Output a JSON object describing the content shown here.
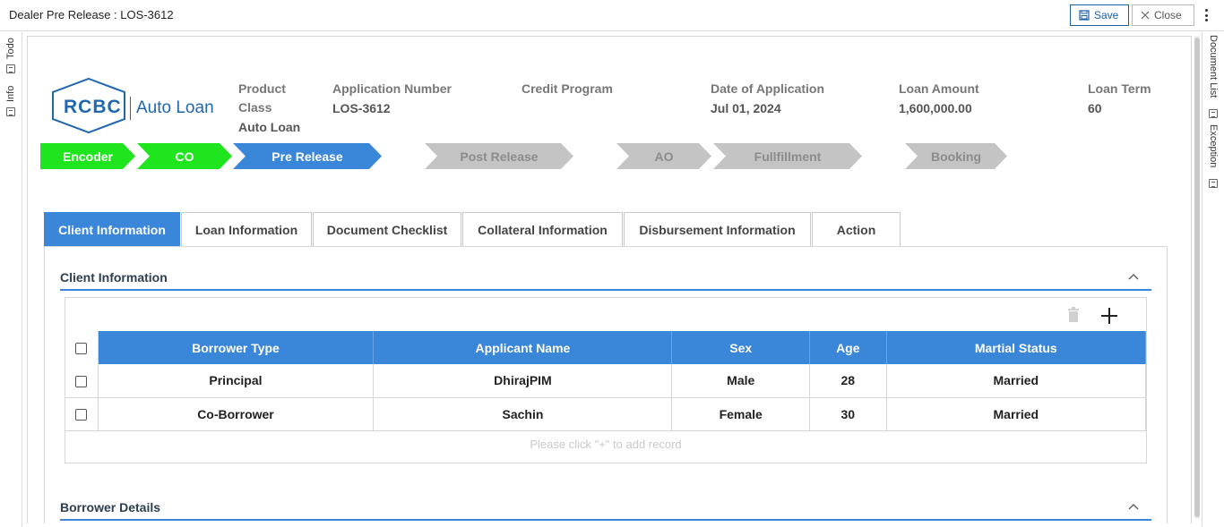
{
  "window": {
    "title": "Dealer Pre Release : LOS-3612",
    "save_label": "Save",
    "close_label": "Close"
  },
  "left_rail": {
    "todo_label": "Todo",
    "info_label": "Info"
  },
  "right_rail": {
    "document_list_label": "Document List",
    "exception_label": "Exception"
  },
  "logo": {
    "brand": "RCBC",
    "product": "Auto Loan"
  },
  "header": {
    "product_class_label": "Product Class",
    "product_class_value": "Auto Loan",
    "application_number_label": "Application Number",
    "application_number_value": "LOS-3612",
    "credit_program_label": "Credit Program",
    "credit_program_value": "",
    "date_label": "Date of Application",
    "date_value": "Jul 01, 2024",
    "loan_amount_label": "Loan Amount",
    "loan_amount_value": "1,600,000.00",
    "loan_term_label": "Loan Term",
    "loan_term_value": "60"
  },
  "stepper": [
    {
      "label": "Encoder",
      "state": "done"
    },
    {
      "label": "CO",
      "state": "done"
    },
    {
      "label": "Pre Release",
      "state": "current"
    },
    {
      "label": "Post Release",
      "state": "todo"
    },
    {
      "label": "AO",
      "state": "todo"
    },
    {
      "label": "Fullfillment",
      "state": "todo"
    },
    {
      "label": "Booking",
      "state": "todo"
    }
  ],
  "tabs": [
    {
      "label": "Client Information",
      "active": true
    },
    {
      "label": "Loan Information"
    },
    {
      "label": "Document Checklist"
    },
    {
      "label": "Collateral Information"
    },
    {
      "label": "Disbursement Information"
    },
    {
      "label": "Action"
    }
  ],
  "client_section": {
    "title": "Client Information",
    "columns": [
      "Borrower Type",
      "Applicant Name",
      "Sex",
      "Age",
      "Martial Status"
    ],
    "rows": [
      [
        "Principal",
        "DhirajPIM",
        "Male",
        "28",
        "Married"
      ],
      [
        "Co-Borrower",
        "Sachin",
        "Female",
        "30",
        "Married"
      ]
    ],
    "empty_hint": "Please click \"+\" to add record"
  },
  "borrower_section": {
    "title": "Borrower Details"
  },
  "colors": {
    "accent": "#3a86d8",
    "done": "#1ee51e",
    "todo": "#c4c4c4",
    "brand": "#1f67b0"
  }
}
